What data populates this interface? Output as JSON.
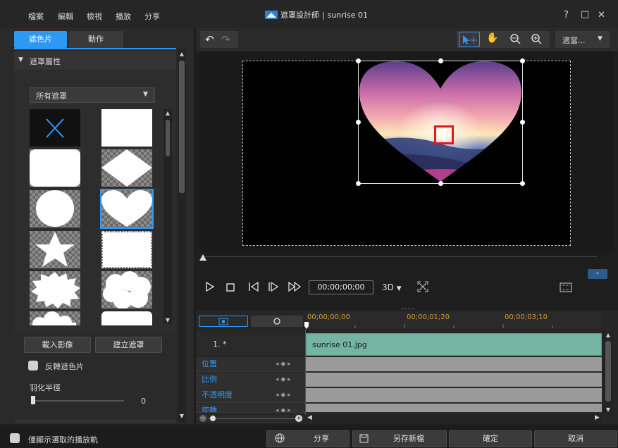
{
  "menu": [
    "檔案",
    "編輯",
    "檢視",
    "播放",
    "分享"
  ],
  "title": {
    "app": "遮罩設計師",
    "separator": "|",
    "file": "sunrise 01"
  },
  "window_controls": {
    "help": "?",
    "maximize": "□",
    "close": "✕"
  },
  "tabs": {
    "mask": "遮色片",
    "motion": "動作"
  },
  "section": {
    "title": "遮罩屬性",
    "expand_glyph": "▼"
  },
  "dropdown": {
    "value": "所有遮罩",
    "arrow": "▼"
  },
  "mask_shapes": [
    "none-x",
    "rectangle",
    "rounded-rectangle",
    "diamond",
    "circle",
    "heart",
    "star",
    "stamp",
    "burst",
    "cloud",
    "cloud-2",
    "rectangle-2"
  ],
  "buttons": {
    "import_image": "載入影像",
    "create_mask": "建立遮罩"
  },
  "invert": {
    "label": "反轉遮色片"
  },
  "feather": {
    "label": "羽化半徑",
    "value": "0",
    "level": 0
  },
  "toolbar": {
    "zoom_label": "適當...",
    "zoom_arrow": "▼"
  },
  "playback": {
    "timecode": "00;00;00;00",
    "mode": "3D",
    "mode_arrow": "▼"
  },
  "timeline": {
    "ruler": [
      "00;00;00;00",
      "00;00;01;20",
      "00;00;03;10"
    ],
    "track_label": "1. *",
    "clip_name": "sunrise 01.jpg",
    "keyframe_rows": [
      "位置",
      "比例",
      "不透明度",
      "旋轉"
    ]
  },
  "bottom": {
    "only_selected_label": "僅顯示選取的播放軌",
    "share": "分享",
    "save_as_new": "另存新檔",
    "ok": "確定",
    "cancel": "取消"
  },
  "colors": {
    "accent": "#2e98f5",
    "selection_red": "#e0191e",
    "clip": "#73b4a2"
  }
}
